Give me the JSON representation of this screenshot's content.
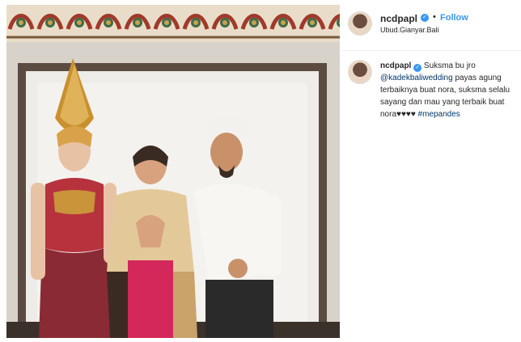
{
  "post": {
    "username": "ncdpapl",
    "verified_badge": "✓",
    "separator": "•",
    "follow_label": "Follow",
    "location": "Ubud.Gianyar.Bali"
  },
  "caption": {
    "username": "ncdpapl",
    "text_1": "Suksma bu jro",
    "mention": "@kadekbaliwedding",
    "text_2": "payas agung terbaiknya buat nora, suksma selalu sayang dan mau yang terbaik buat nora♥♥♥♥",
    "hashtag": "#mepandes"
  },
  "colors": {
    "accent": "#3897f0",
    "link": "#00376b"
  },
  "icons": {
    "verified": "verified-badge-icon"
  }
}
